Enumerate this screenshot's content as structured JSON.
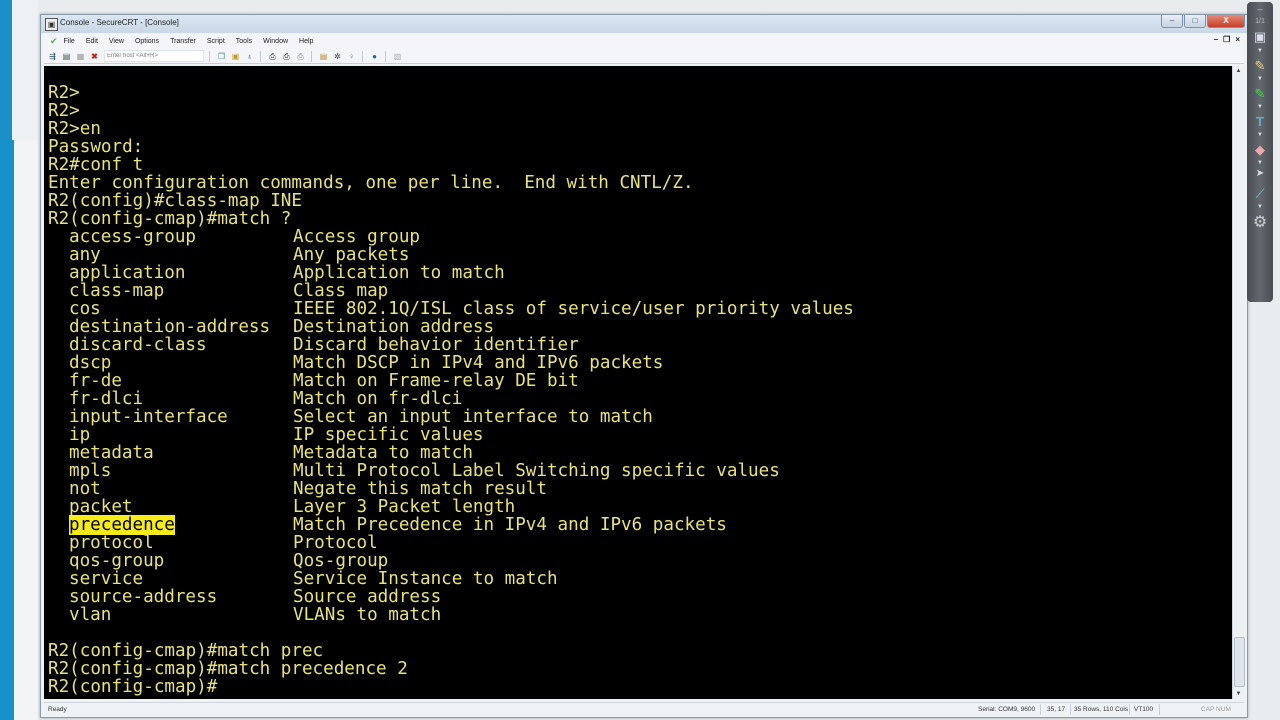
{
  "window": {
    "title": "Console - SecureCRT - [Console]",
    "controls": {
      "minimize": "–",
      "maximize": "□",
      "close": "X"
    },
    "mdi_controls": {
      "minimize": "–",
      "restore": "❐",
      "close": "×"
    }
  },
  "menu": {
    "items": [
      "File",
      "Edit",
      "View",
      "Options",
      "Transfer",
      "Script",
      "Tools",
      "Window",
      "Help"
    ]
  },
  "toolbar": {
    "host_placeholder": "Enter host <Alt+R>",
    "icons_left": [
      "connect-icon",
      "quick-connect-icon",
      "connect-tab-icon",
      "disconnect-icon"
    ],
    "icons_right": [
      "copy-icon",
      "paste-icon",
      "find-icon",
      "print-icon",
      "print-selection-icon",
      "print-setup-icon",
      "session-options-icon",
      "global-options-icon",
      "keymap-icon",
      "help-icon",
      "about-icon"
    ]
  },
  "terminal": {
    "header_lines": [
      "R2>",
      "R2>",
      "R2>en",
      "Password:",
      "R2#conf t",
      "Enter configuration commands, one per line.  End with CNTL/Z.",
      "R2(config)#class-map INE",
      "R2(config-cmap)#match ?"
    ],
    "options": [
      {
        "name": "access-group",
        "desc": "Access group"
      },
      {
        "name": "any",
        "desc": "Any packets"
      },
      {
        "name": "application",
        "desc": "Application to match"
      },
      {
        "name": "class-map",
        "desc": "Class map"
      },
      {
        "name": "cos",
        "desc": "IEEE 802.1Q/ISL class of service/user priority values"
      },
      {
        "name": "destination-address",
        "desc": "Destination address"
      },
      {
        "name": "discard-class",
        "desc": "Discard behavior identifier"
      },
      {
        "name": "dscp",
        "desc": "Match DSCP in IPv4 and IPv6 packets"
      },
      {
        "name": "fr-de",
        "desc": "Match on Frame-relay DE bit"
      },
      {
        "name": "fr-dlci",
        "desc": "Match on fr-dlci"
      },
      {
        "name": "input-interface",
        "desc": "Select an input interface to match"
      },
      {
        "name": "ip",
        "desc": "IP specific values"
      },
      {
        "name": "metadata",
        "desc": "Metadata to match"
      },
      {
        "name": "mpls",
        "desc": "Multi Protocol Label Switching specific values"
      },
      {
        "name": "not",
        "desc": "Negate this match result"
      },
      {
        "name": "packet",
        "desc": "Layer 3 Packet length"
      },
      {
        "name": "precedence",
        "desc": "Match Precedence in IPv4 and IPv6 packets",
        "highlighted": true
      },
      {
        "name": "protocol",
        "desc": "Protocol"
      },
      {
        "name": "qos-group",
        "desc": "Qos-group"
      },
      {
        "name": "service",
        "desc": "Service Instance to match"
      },
      {
        "name": "source-address",
        "desc": "Source address"
      },
      {
        "name": "vlan",
        "desc": "VLANs to match"
      }
    ],
    "footer_lines": [
      "",
      "R2(config-cmap)#match prec",
      "R2(config-cmap)#match precedence 2",
      "R2(config-cmap)#"
    ],
    "text_color": "#e8e27c",
    "highlight_color": "#f6ec18"
  },
  "statusbar": {
    "ready": "Ready",
    "serial": "Serial: COM9, 9600",
    "cursor": "35,  17",
    "size": "35 Rows, 110 Cols",
    "emulation": "VT100",
    "keys": "CAP  NUM"
  },
  "annotation_toolbar": {
    "page": "1/1",
    "tools": [
      "screen-icon",
      "pencil-icon",
      "highlighter-icon",
      "text-icon",
      "eraser-icon",
      "pointer-icon",
      "line-icon",
      "gear-icon"
    ]
  }
}
